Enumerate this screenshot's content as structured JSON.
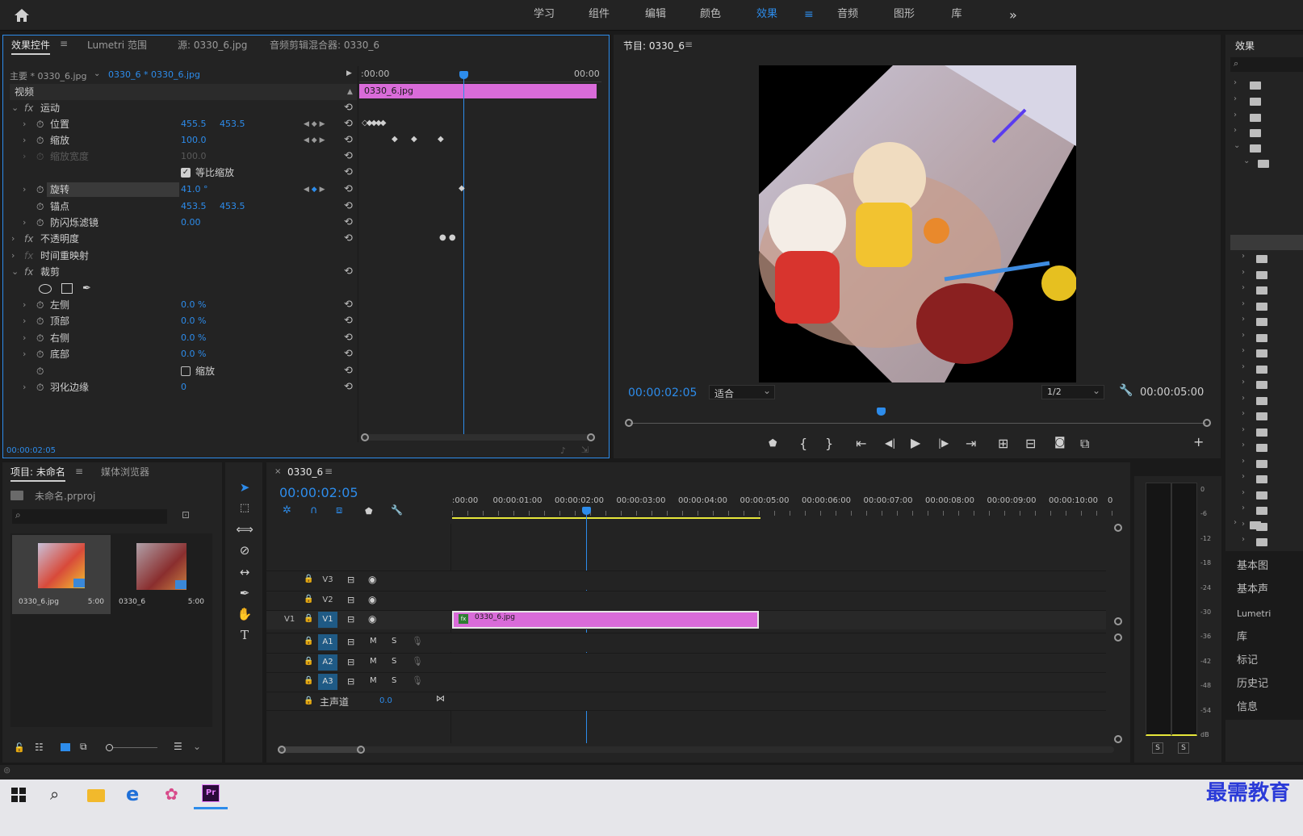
{
  "workspaces": [
    "学习",
    "组件",
    "编辑",
    "颜色",
    "效果",
    "音频",
    "图形",
    "库"
  ],
  "active_workspace": "效果",
  "effect_controls": {
    "tabs": [
      "效果控件",
      "Lumetri 范围",
      "源: 0330_6.jpg",
      "音频剪辑混合器: 0330_6"
    ],
    "master_label": "主要 * 0330_6.jpg",
    "clip_label": "0330_6 * 0330_6.jpg",
    "tl_start": ":00:00",
    "tl_end": "00:00",
    "clip_bar": "0330_6.jpg",
    "video_header": "视频",
    "motion": "运动",
    "position": {
      "label": "位置",
      "x": "455.5",
      "y": "453.5"
    },
    "scale": {
      "label": "缩放",
      "value": "100.0"
    },
    "scale_width": {
      "label": "缩放宽度",
      "value": "100.0"
    },
    "uniform_scale": "等比缩放",
    "rotation": {
      "label": "旋转",
      "value": "41.0 °"
    },
    "anchor": {
      "label": "锚点",
      "x": "453.5",
      "y": "453.5"
    },
    "anti_flicker": {
      "label": "防闪烁滤镜",
      "value": "0.00"
    },
    "opacity": "不透明度",
    "time_remap": "时间重映射",
    "crop": "裁剪",
    "crop_left": {
      "label": "左侧",
      "value": "0.0 %"
    },
    "crop_top": {
      "label": "顶部",
      "value": "0.0 %"
    },
    "crop_right": {
      "label": "右侧",
      "value": "0.0 %"
    },
    "crop_bottom": {
      "label": "底部",
      "value": "0.0 %"
    },
    "zoom": "缩放",
    "feather": {
      "label": "羽化边缘",
      "value": "0"
    },
    "timecode": "00:00:02:05"
  },
  "program": {
    "title": "节目: 0330_6",
    "timecode": "00:00:02:05",
    "fit": "适合",
    "resolution": "1/2",
    "duration": "00:00:05:00"
  },
  "effects_panel": {
    "title": "效果",
    "items": [
      "基本图",
      "基本声",
      "Lumetri",
      "库",
      "标记",
      "历史记",
      "信息"
    ]
  },
  "project": {
    "tabs": [
      "项目: 未命名",
      "媒体浏览器"
    ],
    "file": "未命名.prproj",
    "items": [
      {
        "name": "0330_6.jpg",
        "dur": "5:00"
      },
      {
        "name": "0330_6",
        "dur": "5:00"
      }
    ]
  },
  "timeline": {
    "sequence": "0330_6",
    "timecode": "00:00:02:05",
    "ruler": [
      ":00:00",
      "00:00:01:00",
      "00:00:02:00",
      "00:00:03:00",
      "00:00:04:00",
      "00:00:05:00",
      "00:00:06:00",
      "00:00:07:00",
      "00:00:08:00",
      "00:00:09:00",
      "00:00:10:00",
      "0"
    ],
    "tracks_video": [
      "V3",
      "V2",
      "V1"
    ],
    "tracks_audio": [
      "A1",
      "A2",
      "A3"
    ],
    "source_v1": "V1",
    "master_label": "主声道",
    "master_value": "0.0",
    "clip": "0330_6.jpg"
  },
  "meter": {
    "scale": [
      "0",
      "-6",
      "-12",
      "-18",
      "-24",
      "-30",
      "-36",
      "-42",
      "-48",
      "-54",
      "dB"
    ],
    "solo": [
      "S",
      "S"
    ]
  },
  "watermark": "最需教育"
}
